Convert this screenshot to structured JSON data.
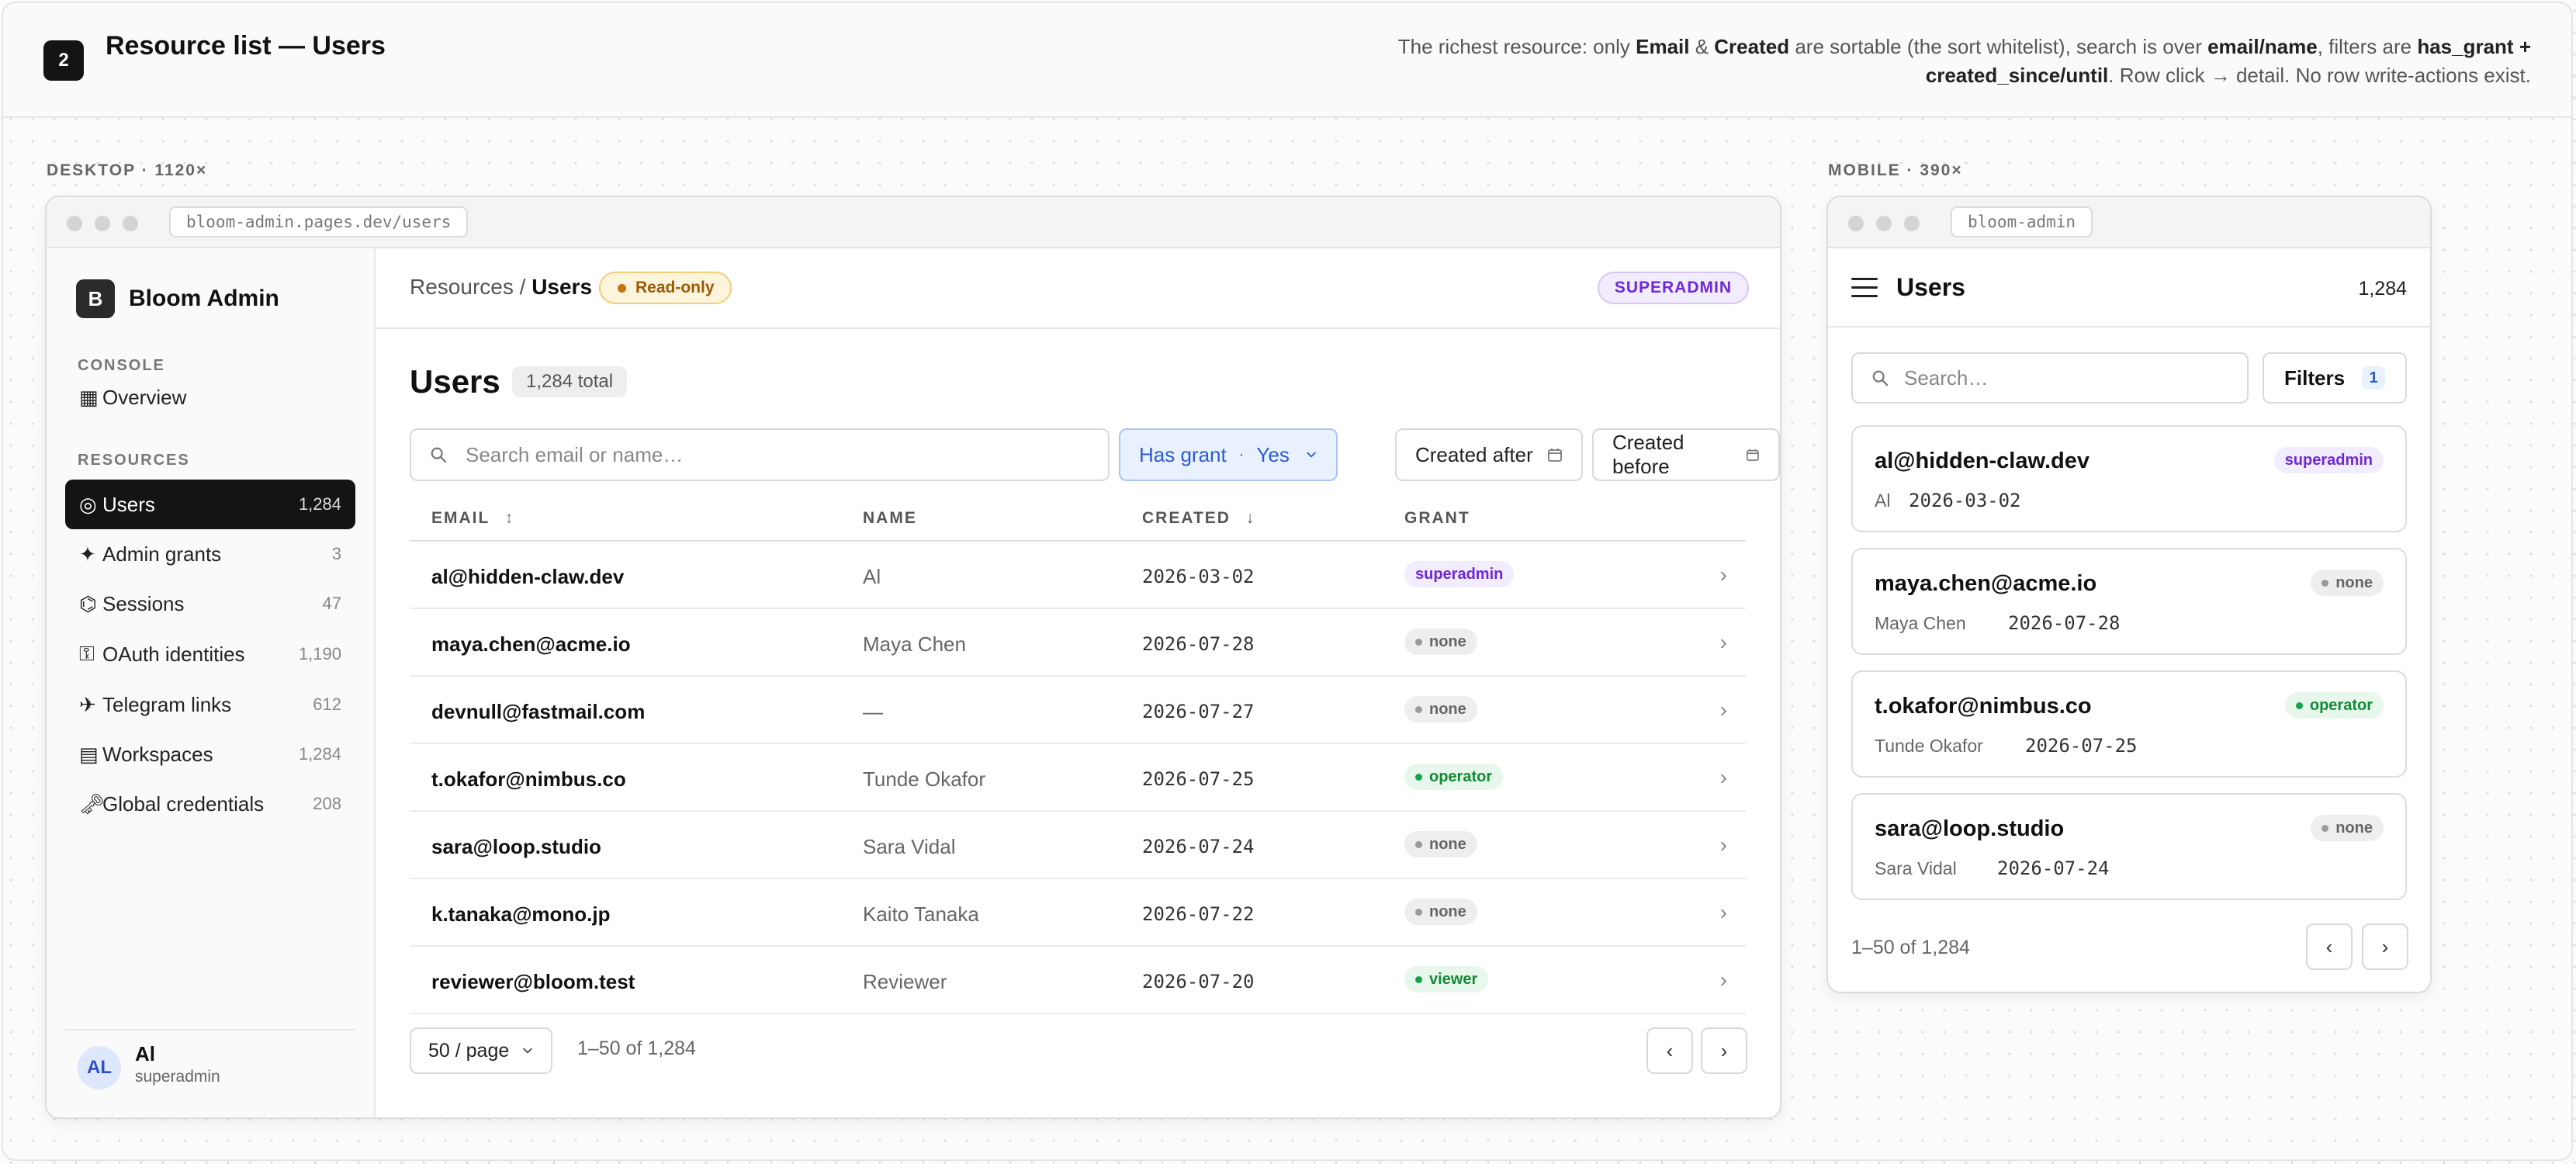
{
  "header": {
    "step": "2",
    "title": "Resource list — Users",
    "desc_parts": [
      "The richest resource: only ",
      "Email",
      " & ",
      "Created",
      " are sortable (the sort whitelist), search is over ",
      "email/name",
      ", filters are ",
      "has_grant + created_since/until",
      ". Row click → detail. No row write-actions exist."
    ]
  },
  "desktop": {
    "label": "DESKTOP · 1120×",
    "url": "bloom-admin.pages.dev/users",
    "brand": {
      "logo": "B",
      "name": "Bloom Admin"
    },
    "nav_groups": {
      "console": "CONSOLE",
      "resources": "RESOURCES"
    },
    "nav": [
      {
        "icon": "▦",
        "label": "Overview",
        "count": ""
      },
      {
        "icon": "◎",
        "label": "Users",
        "count": "1,284"
      },
      {
        "icon": "✦",
        "label": "Admin grants",
        "count": "3"
      },
      {
        "icon": "⌬",
        "label": "Sessions",
        "count": "47"
      },
      {
        "icon": "⚿",
        "label": "OAuth identities",
        "count": "1,190"
      },
      {
        "icon": "✈",
        "label": "Telegram links",
        "count": "612"
      },
      {
        "icon": "▤",
        "label": "Workspaces",
        "count": "1,284"
      },
      {
        "icon": "🗝",
        "label": "Global credentials",
        "count": "208"
      }
    ],
    "user": {
      "initials": "AL",
      "name": "Al",
      "role": "superadmin"
    },
    "breadcrumb": {
      "parent": "Resources",
      "sep": " / ",
      "current": "Users"
    },
    "readonly_badge": "Read-only",
    "role_badge": "SUPERADMIN",
    "title": "Users",
    "total": "1,284 total",
    "search_placeholder": "Search email or name…",
    "filters": {
      "has_grant_label": "Has grant",
      "has_grant_value": "Yes",
      "created_after": "Created after",
      "created_before": "Created before"
    },
    "columns": {
      "email": "EMAIL",
      "email_sort": "↕",
      "name": "NAME",
      "created": "CREATED",
      "created_sort": "↓",
      "grant": "GRANT"
    },
    "rows": [
      {
        "email": "al@hidden-claw.dev",
        "name": "Al",
        "created": "2026-03-02",
        "grant": "superadmin"
      },
      {
        "email": "maya.chen@acme.io",
        "name": "Maya Chen",
        "created": "2026-07-28",
        "grant": "none"
      },
      {
        "email": "devnull@fastmail.com",
        "name": "—",
        "created": "2026-07-27",
        "grant": "none"
      },
      {
        "email": "t.okafor@nimbus.co",
        "name": "Tunde Okafor",
        "created": "2026-07-25",
        "grant": "operator"
      },
      {
        "email": "sara@loop.studio",
        "name": "Sara Vidal",
        "created": "2026-07-24",
        "grant": "none"
      },
      {
        "email": "k.tanaka@mono.jp",
        "name": "Kaito Tanaka",
        "created": "2026-07-22",
        "grant": "none"
      },
      {
        "email": "reviewer@bloom.test",
        "name": "Reviewer",
        "created": "2026-07-20",
        "grant": "viewer"
      }
    ],
    "pager": {
      "per_page": "50 / page",
      "range": "1–50 of 1,284",
      "prev": "‹",
      "next": "›"
    }
  },
  "mobile": {
    "label": "MOBILE · 390×",
    "url": "bloom-admin",
    "title": "Users",
    "count": "1,284",
    "search_placeholder": "Search…",
    "filters_label": "Filters",
    "filters_count": "1",
    "cards": [
      {
        "email": "al@hidden-claw.dev",
        "name": "Al",
        "created": "2026-03-02",
        "grant": "superadmin"
      },
      {
        "email": "maya.chen@acme.io",
        "name": "Maya Chen",
        "created": "2026-07-28",
        "grant": "none"
      },
      {
        "email": "t.okafor@nimbus.co",
        "name": "Tunde Okafor",
        "created": "2026-07-25",
        "grant": "operator"
      },
      {
        "email": "sara@loop.studio",
        "name": "Sara Vidal",
        "created": "2026-07-24",
        "grant": "none"
      }
    ],
    "range": "1–50 of 1,284",
    "prev": "‹",
    "next": "›"
  },
  "colors": {
    "accent": "#2c5bd1",
    "superadmin": "#6d28d9",
    "operator": "#16a34a",
    "warning": "#c7720a"
  }
}
